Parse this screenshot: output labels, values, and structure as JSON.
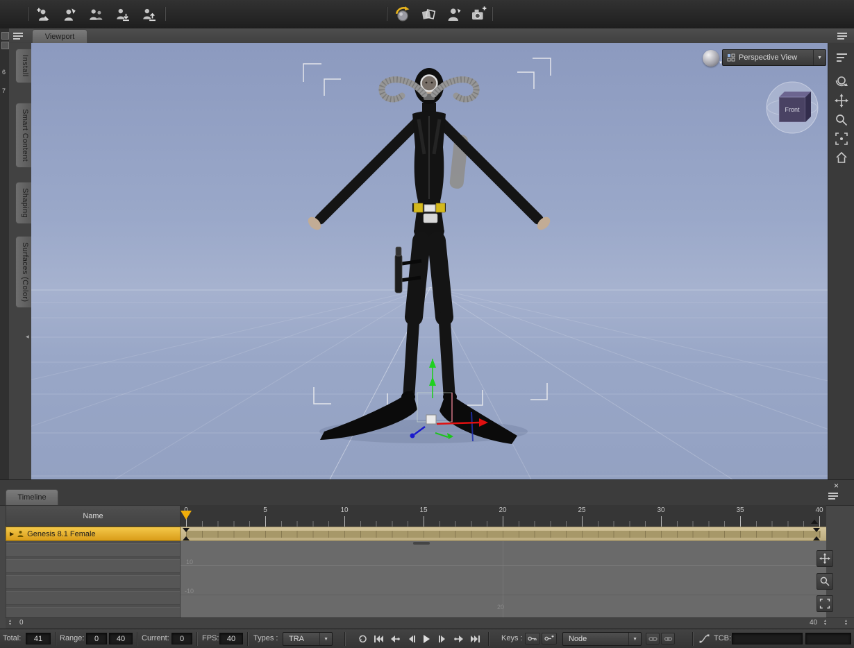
{
  "glyphs": {
    "dropdown_arrow": "▼",
    "expander": "▶",
    "close": "×",
    "spin_up": "▲",
    "spin_down": "▼",
    "collapse_left": "◀"
  },
  "top_toolbar": {
    "left_icons": [
      "add-figure-icon",
      "pose-figure-icon",
      "duplicate-figures-icon",
      "save-figure-icon",
      "load-figure-icon"
    ],
    "center_icons": [
      "render-icon",
      "surfaces-icon",
      "character-icon",
      "camera-icon"
    ]
  },
  "left_panel": {
    "rail_labels": [
      "6",
      "7"
    ],
    "tabs": [
      "Install",
      "Smart Content",
      "Shaping",
      "Surfaces (Color)"
    ]
  },
  "viewport": {
    "tab_label": "Viewport",
    "view_selector_label": "Perspective View",
    "nav_cube_label": "Front",
    "nav_icons": [
      "pane-options-icon",
      "display-options-icon",
      "orbit-view-icon",
      "pan-view-icon",
      "zoom-view-icon",
      "frame-view-icon",
      "home-view-icon"
    ]
  },
  "timeline": {
    "tab_label": "Timeline",
    "name_header": "Name",
    "track_name": "Genesis 8.1 Female",
    "ruler_labels": [
      "0",
      "5",
      "10",
      "15",
      "20",
      "25",
      "30",
      "35",
      "40"
    ],
    "graph_value_upper": "10",
    "graph_value_lower": "-10",
    "graph_frame_label": "20",
    "range_start": "0",
    "range_end": "40",
    "tool_icons": [
      "pan-timeline-icon",
      "zoom-timeline-icon",
      "frame-timeline-icon"
    ]
  },
  "status_bar": {
    "total_label": "Total:",
    "total_value": "41",
    "range_label": "Range:",
    "range_start": "0",
    "range_end": "40",
    "current_label": "Current:",
    "current_value": "0",
    "fps_label": "FPS:",
    "fps_value": "40",
    "types_label": "Types :",
    "types_value": "TRA",
    "keys_label": "Keys :",
    "node_value": "Node",
    "tcb_label": "TCB:",
    "tcb_value": "",
    "playback_icons": [
      "loop-icon",
      "go-to-start-icon",
      "previous-key-icon",
      "previous-frame-icon",
      "play-icon",
      "next-frame-icon",
      "next-key-icon",
      "go-to-end-icon"
    ]
  }
}
